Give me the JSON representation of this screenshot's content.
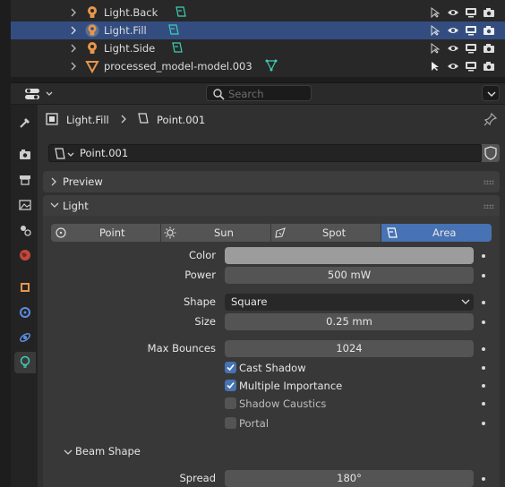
{
  "outliner": {
    "rows": [
      {
        "label": "Light.Back",
        "selected": false
      },
      {
        "label": "Light.Fill",
        "selected": true
      },
      {
        "label": "Light.Side",
        "selected": false
      },
      {
        "label": "processed_model-model.003",
        "selected": false
      }
    ]
  },
  "header": {
    "search_placeholder": "Search"
  },
  "breadcrumb": {
    "object": "Light.Fill",
    "data": "Point.001"
  },
  "datablock": {
    "name": "Point.001"
  },
  "panels": {
    "preview": "Preview",
    "light": "Light",
    "beam_shape": "Beam Shape"
  },
  "light_types": [
    {
      "label": "Point"
    },
    {
      "label": "Sun"
    },
    {
      "label": "Spot"
    },
    {
      "label": "Area",
      "active": true
    }
  ],
  "props": {
    "color_label": "Color",
    "color_value": "#9c9c9c",
    "power_label": "Power",
    "power_value": "500 mW",
    "shape_label": "Shape",
    "shape_value": "Square",
    "size_label": "Size",
    "size_value": "0.25 mm",
    "bounces_label": "Max Bounces",
    "bounces_value": "1024",
    "cast_shadow": "Cast Shadow",
    "multi_importance": "Multiple Importance",
    "shadow_caustics": "Shadow Caustics",
    "portal": "Portal",
    "spread_label": "Spread",
    "spread_value": "180°"
  },
  "checkboxes": {
    "cast_shadow": true,
    "multi_importance": true,
    "shadow_caustics": false,
    "portal": false
  },
  "colors": {
    "accent": "#4772b3",
    "selection": "#334d80",
    "teal": "#3ecfb4",
    "orange": "#e8964a"
  },
  "icons": [
    "chevron-right-icon",
    "light-bulb-icon",
    "light-data-icon",
    "mesh-triangle-icon",
    "cursor-icon",
    "eye-icon",
    "monitor-icon",
    "camera-icon",
    "search-icon",
    "pin-icon",
    "shield-icon"
  ]
}
